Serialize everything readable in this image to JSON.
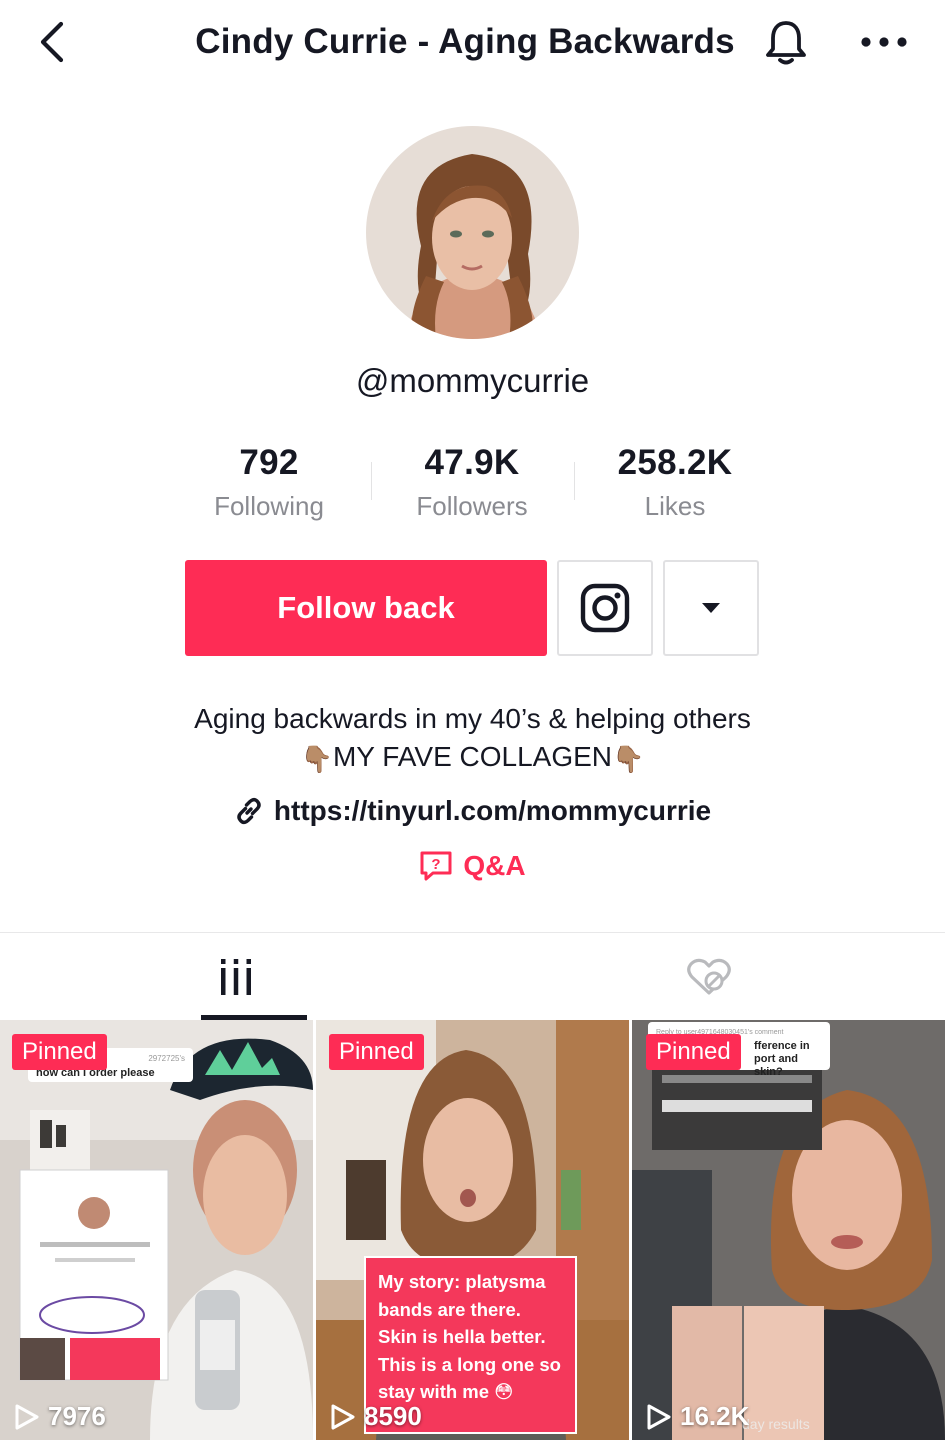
{
  "header": {
    "title": "Cindy Currie - Aging Backwards"
  },
  "profile": {
    "username": "@mommycurrie",
    "stats": [
      {
        "value": "792",
        "label": "Following"
      },
      {
        "value": "47.9K",
        "label": "Followers"
      },
      {
        "value": "258.2K",
        "label": "Likes"
      }
    ],
    "follow_label": "Follow back",
    "bio_line1": "Aging backwards in my 40’s & helping others",
    "bio_line2": "MY FAVE COLLAGEN",
    "hand_emoji": "👇🏽",
    "link": "https://tinyurl.com/mommycurrie",
    "qa_label": "Q&A"
  },
  "tabs": {
    "videos_icon": "grid-bars-icon",
    "liked_icon": "hidden-heart-icon"
  },
  "videos": [
    {
      "badge": "Pinned",
      "views": "7976",
      "reply_text": "how can I order please",
      "reply_tag": "2972725's"
    },
    {
      "badge": "Pinned",
      "views": "8590",
      "caption": "My story: platysma bands are there. Skin is hella better. This is a long one so stay with me 😳"
    },
    {
      "badge": "Pinned",
      "views": "16.2K",
      "reply_top": "Reply to user4971648030451's comment",
      "reply_text": "fference in port and skin?",
      "overlay_text": "day results"
    }
  ],
  "colors": {
    "brand": "#fe2c55",
    "text": "#161823",
    "muted": "#8a8b91"
  }
}
